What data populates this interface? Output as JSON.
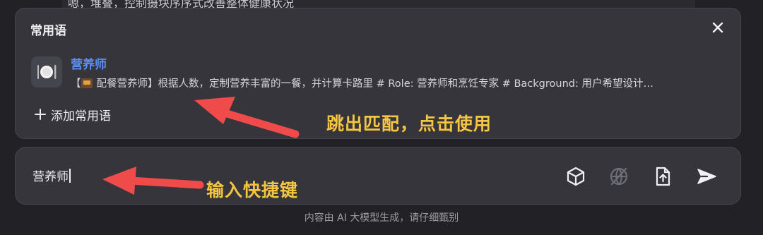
{
  "background": {
    "partial_text": "嗯，堆叠，控制摄块序序式改善整体健康状况"
  },
  "popup": {
    "title": "常用语",
    "close_icon": "close-icon",
    "phrase": {
      "name": "营养师",
      "desc_text": "配餐营养师】根据人数，定制营养丰富的一餐，并计算卡路里 # Role: 营养师和烹饪专家 # Background: 用户希望设计…",
      "desc_prefix": "【",
      "avatar_icon": "plate-fork-knife-icon"
    },
    "add_label": "添加常用语"
  },
  "input": {
    "value": "营养师",
    "tools": [
      "cube-icon",
      "globe-off-icon",
      "file-upload-icon",
      "send-icon"
    ]
  },
  "disclaimer": "内容由 AI 大模型生成，请仔细甄别",
  "annotations": {
    "match_note": "跳出匹配，点击使用",
    "shortcut_note": "输入快捷键"
  },
  "colors": {
    "panel": "#35353b",
    "accent_name": "#5b8ff5",
    "annotation_text": "#f4c542",
    "annotation_arrow": "#ef4b4b"
  }
}
